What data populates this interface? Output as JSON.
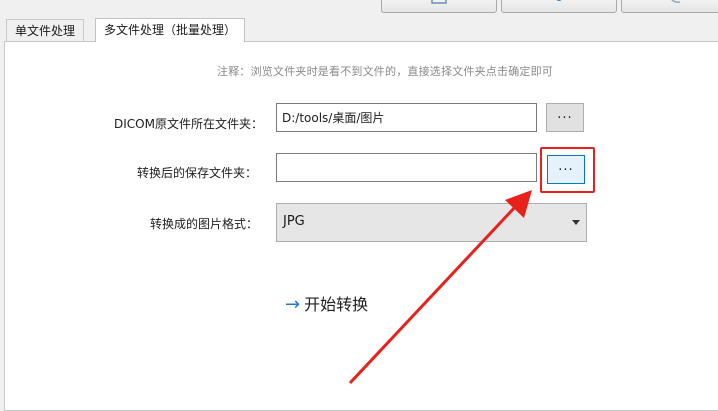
{
  "tabs": [
    {
      "label": "单文件处理",
      "active": false
    },
    {
      "label": "多文件处理（批量处理）",
      "active": true
    }
  ],
  "note": "注释：浏览文件夹时是看不到文件的，直接选择文件夹点击确定即可",
  "source_folder": {
    "label": "DICOM原文件所在文件夹：",
    "value": "D:/tools/桌面/图片",
    "browse_label": "..."
  },
  "output_folder": {
    "label": "转换后的保存文件夹：",
    "value": "",
    "browse_label": "..."
  },
  "format": {
    "label": "转换成的图片格式：",
    "selected": "JPG"
  },
  "start": {
    "arrow": "→",
    "label": "开始转换"
  },
  "colors": {
    "annotation": "#e8211b",
    "accent": "#1f7ad6"
  }
}
